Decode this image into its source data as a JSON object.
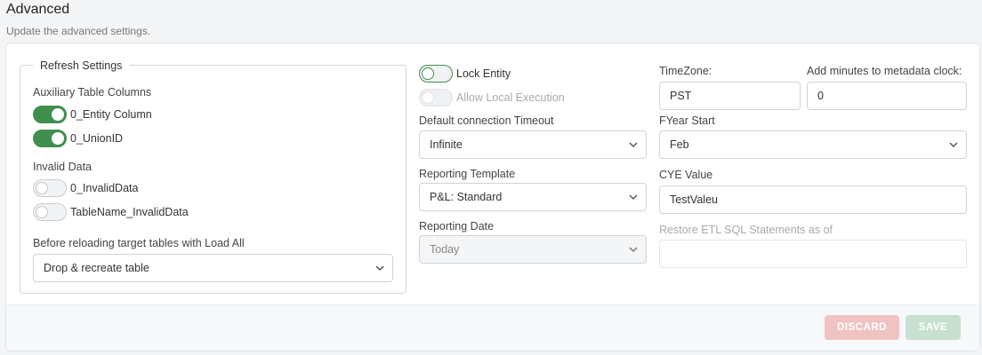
{
  "header": {
    "title": "Advanced",
    "subtitle": "Update the advanced settings."
  },
  "refresh": {
    "legend": "Refresh Settings",
    "aux_label": "Auxiliary Table Columns",
    "entity_column": "0_Entity Column",
    "union_id": "0_UnionID",
    "invalid_label": "Invalid Data",
    "invalid_data": "0_InvalidData",
    "tablename_invalid": "TableName_InvalidData",
    "reload_label": "Before reloading target tables with Load All",
    "reload_value": "Drop & recreate table"
  },
  "middle": {
    "lock_entity": "Lock Entity",
    "allow_local": "Allow Local Execution",
    "timeout_label": "Default connection Timeout",
    "timeout_value": "Infinite",
    "template_label": "Reporting Template",
    "template_value": "P&L: Standard",
    "date_label": "Reporting Date",
    "date_value": "Today"
  },
  "right": {
    "timezone_label": "TimeZone:",
    "timezone_value": "PST",
    "minutes_label": "Add minutes to metadata clock:",
    "minutes_value": "0",
    "fyear_label": "FYear Start",
    "fyear_value": "Feb",
    "cye_label": "CYE Value",
    "cye_value": "TestValeu",
    "restore_label": "Restore ETL SQL Statements as of",
    "restore_value": ""
  },
  "footer": {
    "discard": "DISCARD",
    "save": "SAVE"
  },
  "colors": {
    "toggle_on": "#3f8f4f",
    "discard": "#f0c3c3",
    "save": "#c7e0cf"
  }
}
